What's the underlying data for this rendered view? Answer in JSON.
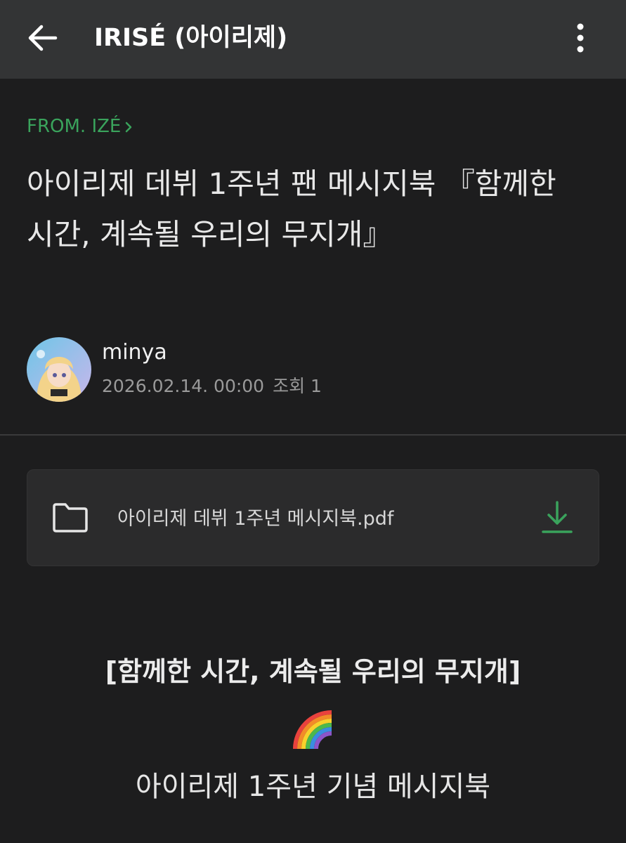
{
  "app_bar": {
    "title": "IRISÉ (아이리제)",
    "back_icon": "arrow-left-icon",
    "more_icon": "more-vertical-icon"
  },
  "post": {
    "board_label": "FROM. IZÉ",
    "title": "아이리제 데뷔 1주년 팬 메시지북 『함께한 시간, 계속될 우리의 무지개』",
    "author": {
      "name": "minya",
      "date": "2026.02.14. 00:00",
      "views_label": "조회 1"
    },
    "attachment": {
      "file_name": "아이리제 데뷔 1주년 메시지북.pdf",
      "folder_icon": "folder-icon",
      "download_icon": "download-icon"
    },
    "body": {
      "heading": "[함께한 시간, 계속될 우리의 무지개]",
      "emoji_icon": "rainbow-icon",
      "subline": "아이리제 1주년 기념 메시지북"
    }
  },
  "colors": {
    "background": "#1d1d1e",
    "app_bar": "#333435",
    "accent_green": "#3aa35c",
    "card": "#2b2b2c",
    "meta_text": "#9a9a9a"
  }
}
